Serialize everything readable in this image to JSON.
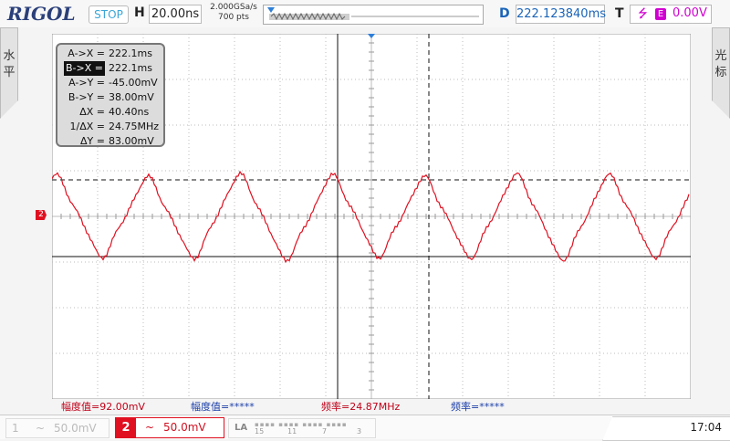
{
  "header": {
    "logo": "RIGOL",
    "run_state": "STOP",
    "horizontal_label": "H",
    "timebase": "20.00ns",
    "sample_rate": "2.000GSa/s",
    "memory_depth": "700 pts",
    "delay_label": "D",
    "delay_value": "222.123840ms",
    "trigger_label": "T",
    "trigger_source": "E",
    "trigger_level": "0.00V"
  },
  "side_buttons": {
    "left": [
      "水",
      "平"
    ],
    "right": [
      "光",
      "标"
    ]
  },
  "cursor_readout": {
    "rows": [
      {
        "label": "A->X =",
        "value": "222.1ms",
        "selected": false
      },
      {
        "label": "B->X =",
        "value": "222.1ms",
        "selected": true
      },
      {
        "label": "A->Y =",
        "value": "-45.00mV",
        "selected": false
      },
      {
        "label": "B->Y =",
        "value": "38.00mV",
        "selected": false
      },
      {
        "label": "ΔX =",
        "value": "40.40ns",
        "selected": false
      },
      {
        "label": "1/ΔX =",
        "value": "24.75MHz",
        "selected": false
      },
      {
        "label": "ΔY =",
        "value": "83.00mV",
        "selected": false
      }
    ]
  },
  "channel2_marker": "2",
  "measurements": [
    {
      "text": "幅度值=92.00mV",
      "color": "#c00018"
    },
    {
      "text": "幅度值=*****",
      "color": "#1a3ea8"
    },
    {
      "text": "频率=24.87MHz",
      "color": "#c00018"
    },
    {
      "text": "频率=*****",
      "color": "#1a3ea8"
    }
  ],
  "channels": {
    "ch1": {
      "number": "1",
      "coupling": "~",
      "scale": "50.0mV",
      "enabled": false
    },
    "ch2": {
      "number": "2",
      "coupling": "~",
      "scale": "50.0mV",
      "enabled": true,
      "color": "#e01020"
    }
  },
  "logic_analyzer": {
    "label": "LA",
    "channel_numbers": [
      "15",
      "11",
      "7",
      "3"
    ]
  },
  "clock": "17:04",
  "colors": {
    "waveform": "#e01020",
    "grid": "#b8b8b8",
    "cursor": "#111111",
    "trigger": "#d000d0"
  }
}
